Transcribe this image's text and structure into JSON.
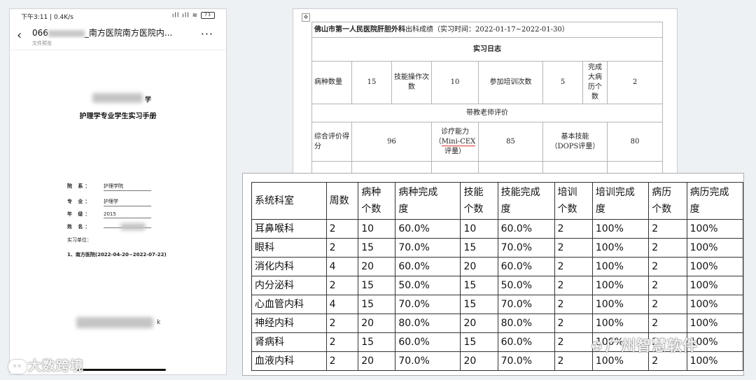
{
  "phone": {
    "status_left": "下午3:11 | 0.4K/s",
    "status_right": "ıll ıll",
    "battery": "73",
    "title_prefix": "066",
    "title_suffix": "_南方医院南方医院内...",
    "subtitle": "文件预览",
    "more": "···",
    "school_suffix": "学",
    "manual_title": "护理学专业学生实习手册",
    "fields": [
      {
        "label": "院 系：",
        "value": "护理学院"
      },
      {
        "label": "专 业：",
        "value": "护理学"
      },
      {
        "label": "年 级：",
        "value": "2015"
      },
      {
        "label": "姓 名：",
        "value": ""
      }
    ],
    "unit_label": "实习单位：",
    "unit_value": "1、南方医院(2022-04-20~2022-07-22)",
    "suffix_char": "k",
    "watermark": "大数跨境"
  },
  "log": {
    "title_bold": "佛山市第一人民医院肝胆外科",
    "title_rest": "出科成绩（实习时间：2022-01-17~2022-01-30）",
    "section": "实习日志",
    "r1": {
      "l1": "病种数量",
      "v1": "15",
      "l2": "技能操作次数",
      "v2": "10",
      "l3": "参加培训次数",
      "v3": "5",
      "l4": "完成大病历个数",
      "v4": "2"
    },
    "teacher_eval": "带教老师评价",
    "r2": {
      "l1": "综合评价得分",
      "v1": "96",
      "l2a": "诊疗能力",
      "l2b": "Mini-CEX",
      "l2c": "评量）",
      "l2open": "（",
      "v2": "85",
      "l3a": "基本技能",
      "l3b": "（DOPS评量）",
      "v3": "80"
    }
  },
  "stats": {
    "headers": [
      [
        "系统科室"
      ],
      [
        "周数"
      ],
      [
        "病种",
        "个数"
      ],
      [
        "病种完成",
        "度"
      ],
      [
        "技能",
        "个数"
      ],
      [
        "技能完成",
        "度"
      ],
      [
        "培训",
        "个数"
      ],
      [
        "培训完成",
        "度"
      ],
      [
        "病历",
        "个数"
      ],
      [
        "病历完成",
        "度"
      ]
    ],
    "rows": [
      [
        "耳鼻喉科",
        "2",
        "10",
        "60.0%",
        "10",
        "60.0%",
        "2",
        "100%",
        "2",
        "100%"
      ],
      [
        "眼科",
        "2",
        "15",
        "70.0%",
        "15",
        "70.0%",
        "2",
        "100%",
        "2",
        "100%"
      ],
      [
        "消化内科",
        "4",
        "20",
        "60.0%",
        "20",
        "60.0%",
        "2",
        "100%",
        "2",
        "100%"
      ],
      [
        "内分泌科",
        "2",
        "15",
        "50.0%",
        "15",
        "50.0%",
        "2",
        "100%",
        "2",
        "100%"
      ],
      [
        "心血管内科",
        "4",
        "15",
        "70.0%",
        "15",
        "70.0%",
        "2",
        "100%",
        "2",
        "100%"
      ],
      [
        "神经内科",
        "2",
        "20",
        "80.0%",
        "20",
        "80.0%",
        "2",
        "100%",
        "2",
        "100%"
      ],
      [
        "肾病科",
        "2",
        "15",
        "60.0%",
        "15",
        "60.0%",
        "2",
        "100%",
        "2",
        "100%"
      ],
      [
        "血液内科",
        "2",
        "20",
        "70.0%",
        "20",
        "70.0%",
        "2",
        "100%",
        "2",
        "100%"
      ]
    ]
  },
  "watermark_right": "广州智慧软件"
}
